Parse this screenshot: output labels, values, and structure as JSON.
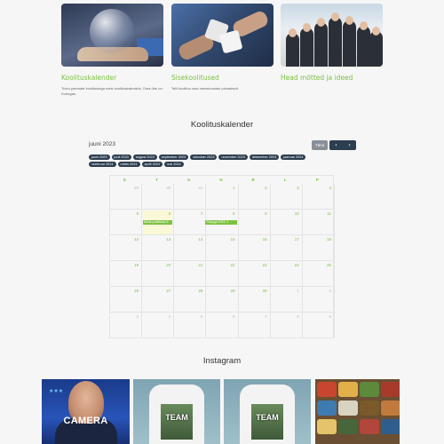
{
  "cards": [
    {
      "title": "Koolituskalender",
      "description": "Tutvu parimate koolitustega meie koolituskalendris. Oma ühe on Kuringas."
    },
    {
      "title": "Sisekoolitused",
      "description": "Telli koolitus oma meeskonnale privaatselt."
    },
    {
      "title": "Head mõtted ja ideed",
      "description": ""
    }
  ],
  "calendar": {
    "section_title": "Koolituskalender",
    "current_month": "juuni 2023",
    "today_label": "Täna",
    "prev_icon": "chevron-left-icon",
    "next_icon": "chevron-right-icon",
    "months": [
      "juuni 2023",
      "juuli 2023",
      "august 2023",
      "september 2023",
      "oktoober 2023",
      "november 2023",
      "detsember 2023",
      "jaanuar 2024",
      "veebruar 2024",
      "märts 2024",
      "aprill 2024",
      "mai 2024"
    ],
    "weekdays": [
      "E",
      "T",
      "K",
      "N",
      "R",
      "L",
      "P"
    ],
    "weeks": [
      [
        {
          "d": "29",
          "other": true
        },
        {
          "d": "30",
          "other": true
        },
        {
          "d": "31",
          "other": true
        },
        {
          "d": "1"
        },
        {
          "d": "2"
        },
        {
          "d": "3"
        },
        {
          "d": "4"
        }
      ],
      [
        {
          "d": "5"
        },
        {
          "d": "6"
        },
        {
          "d": "7"
        },
        {
          "d": "8"
        },
        {
          "d": "9"
        },
        {
          "d": "10"
        },
        {
          "d": "11"
        }
      ],
      [
        {
          "d": "12"
        },
        {
          "d": "13"
        },
        {
          "d": "14"
        },
        {
          "d": "15"
        },
        {
          "d": "16"
        },
        {
          "d": "17"
        },
        {
          "d": "18"
        }
      ],
      [
        {
          "d": "19"
        },
        {
          "d": "20"
        },
        {
          "d": "21"
        },
        {
          "d": "22"
        },
        {
          "d": "23"
        },
        {
          "d": "24"
        },
        {
          "d": "25"
        }
      ],
      [
        {
          "d": "26"
        },
        {
          "d": "27"
        },
        {
          "d": "28"
        },
        {
          "d": "29"
        },
        {
          "d": "30"
        },
        {
          "d": "1",
          "other": true
        },
        {
          "d": "2",
          "other": true
        }
      ],
      [
        {
          "d": "3",
          "other": true
        },
        {
          "d": "4",
          "other": true
        },
        {
          "d": "5",
          "other": true
        },
        {
          "d": "6",
          "other": true
        },
        {
          "d": "7",
          "other": true
        },
        {
          "d": "8",
          "other": true
        },
        {
          "d": "9",
          "other": true
        }
      ]
    ],
    "events": [
      {
        "label": "Müük praktikas! 6"
      },
      {
        "label": "Tööjuga 2023. 2"
      }
    ]
  },
  "instagram": {
    "title": "Instagram",
    "posts": [
      {
        "caption": "CAMERA"
      },
      {
        "caption": "TEAM"
      },
      {
        "caption": "TEAM"
      },
      {
        "caption": ""
      }
    ]
  },
  "colors": {
    "accent": "#7cc242",
    "dark": "#2d3e50",
    "today_highlight": "#fbf8d8"
  }
}
